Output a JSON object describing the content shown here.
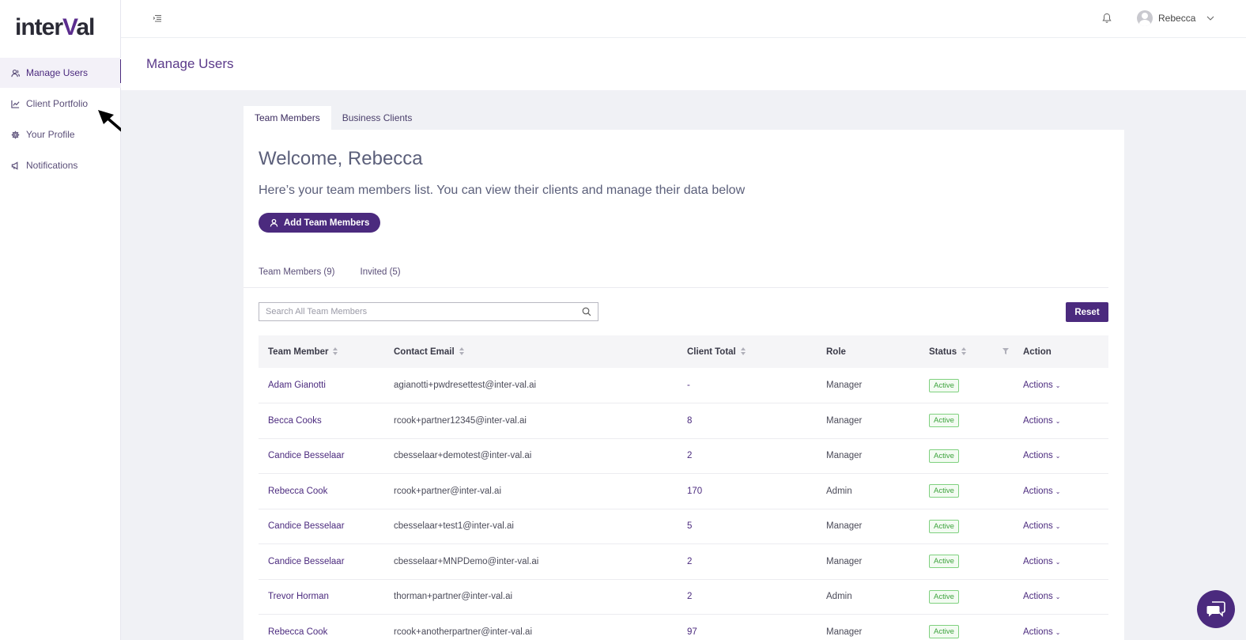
{
  "brand": {
    "logo_prefix": "inter",
    "logo_accent": "V",
    "logo_suffix": "al"
  },
  "sidebar": {
    "items": [
      {
        "label": "Manage Users",
        "icon": "users-icon"
      },
      {
        "label": "Client Portfolio",
        "icon": "chart-icon"
      },
      {
        "label": "Your Profile",
        "icon": "gear-icon"
      },
      {
        "label": "Notifications",
        "icon": "megaphone-icon"
      }
    ]
  },
  "header": {
    "user_name": "Rebecca"
  },
  "page": {
    "title": "Manage Users"
  },
  "tabs": [
    {
      "label": "Team Members"
    },
    {
      "label": "Business Clients"
    }
  ],
  "card": {
    "welcome": "Welcome, Rebecca",
    "subtitle": "Here’s your team members list. You can view their clients and manage their data below",
    "add_button": "Add Team Members",
    "sub_tabs": [
      {
        "label": "Team Members (9)"
      },
      {
        "label": "Invited (5)"
      }
    ],
    "search_placeholder": "Search All Team Members",
    "reset_label": "Reset"
  },
  "table": {
    "columns": [
      "Team Member",
      "Contact Email",
      "Client Total",
      "Role",
      "Status",
      "Action"
    ],
    "rows": [
      {
        "name": "Adam Gianotti",
        "email": "agianotti+pwdresettest@inter-val.ai",
        "total": "-",
        "role": "Manager",
        "status": "Active",
        "action": "Actions"
      },
      {
        "name": "Becca Cooks",
        "email": "rcook+partner12345@inter-val.ai",
        "total": "8",
        "role": "Manager",
        "status": "Active",
        "action": "Actions"
      },
      {
        "name": "Candice Besselaar",
        "email": "cbesselaar+demotest@inter-val.ai",
        "total": "2",
        "role": "Manager",
        "status": "Active",
        "action": "Actions"
      },
      {
        "name": "Rebecca Cook",
        "email": "rcook+partner@inter-val.ai",
        "total": "170",
        "role": "Admin",
        "status": "Active",
        "action": "Actions"
      },
      {
        "name": "Candice Besselaar",
        "email": "cbesselaar+test1@inter-val.ai",
        "total": "5",
        "role": "Manager",
        "status": "Active",
        "action": "Actions"
      },
      {
        "name": "Candice Besselaar",
        "email": "cbesselaar+MNPDemo@inter-val.ai",
        "total": "2",
        "role": "Manager",
        "status": "Active",
        "action": "Actions"
      },
      {
        "name": "Trevor Horman",
        "email": "thorman+partner@inter-val.ai",
        "total": "2",
        "role": "Admin",
        "status": "Active",
        "action": "Actions"
      },
      {
        "name": "Rebecca Cook",
        "email": "rcook+anotherpartner@inter-val.ai",
        "total": "97",
        "role": "Manager",
        "status": "Active",
        "action": "Actions"
      }
    ]
  },
  "colors": {
    "accent": "#4b2a7e",
    "status_active": "#3da33d",
    "content_bg": "#f0f1f5"
  }
}
